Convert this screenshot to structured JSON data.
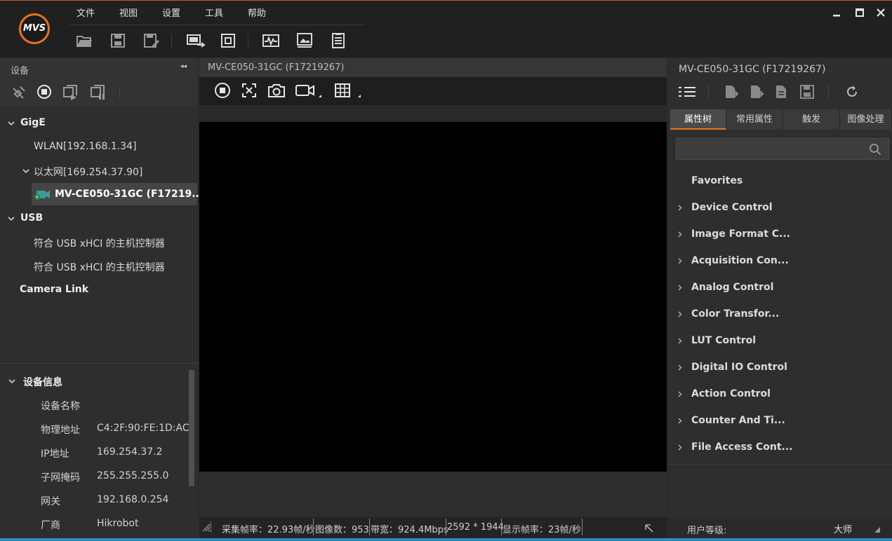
{
  "app": {
    "logo_text": "MVS",
    "menu": [
      "文件",
      "视图",
      "设置",
      "工具",
      "帮助"
    ],
    "toolbar_icons": [
      "open-folder-icon",
      "save-icon",
      "save-as-icon",
      "monitor-share-icon",
      "fit-window-icon",
      "waveform-icon",
      "image-settings-icon",
      "document-list-icon"
    ]
  },
  "left": {
    "title": "设备",
    "collapse_glyph": "◂◂",
    "tree": {
      "gige": "GigE",
      "wlan": "WLAN[192.168.1.34]",
      "ethernet": "以太网[169.254.37.90]",
      "camera": "MV-CE050-31GC (F17219...",
      "usb": "USB",
      "usb_item1": "符合 USB xHCI 的主机控制器",
      "usb_item2": "符合 USB xHCI 的主机控制器",
      "cameralink": "Camera Link"
    },
    "info": {
      "title": "设备信息",
      "rows": [
        {
          "label": "设备名称",
          "value": ""
        },
        {
          "label": "物理地址",
          "value": "C4:2F:90:FE:1D:AC"
        },
        {
          "label": "IP地址",
          "value": "169.254.37.2"
        },
        {
          "label": "子网掩码",
          "value": "255.255.255.0"
        },
        {
          "label": "网关",
          "value": "192.168.0.254"
        },
        {
          "label": "厂商",
          "value": "Hikrobot"
        }
      ]
    }
  },
  "center": {
    "title": "MV-CE050-31GC (F17219267)",
    "status": {
      "fps": "采集帧率：22.93帧/秒",
      "images": "图像数：953",
      "bandwidth": "带宽：924.4Mbps",
      "resolution": "2592 * 1944",
      "display_fps": "显示帧率：23帧/秒"
    }
  },
  "right": {
    "title": "MV-CE050-31GC (F17219267)",
    "tabs": [
      "属性树",
      "常用属性",
      "触发",
      "图像处理"
    ],
    "search_placeholder": "",
    "favorites": "Favorites",
    "properties": [
      "Device Control",
      "Image Format C...",
      "Acquisition Con...",
      "Analog Control",
      "Color Transfor...",
      "LUT Control",
      "Digital IO Control",
      "Action Control",
      "Counter And Ti...",
      "File Access Cont..."
    ],
    "user_level_label": "用户等级:",
    "user_level_value": "大师"
  },
  "colors": {
    "accent": "#e8731c",
    "panel_bg": "#2e2e2e",
    "video_bg": "#000000"
  }
}
